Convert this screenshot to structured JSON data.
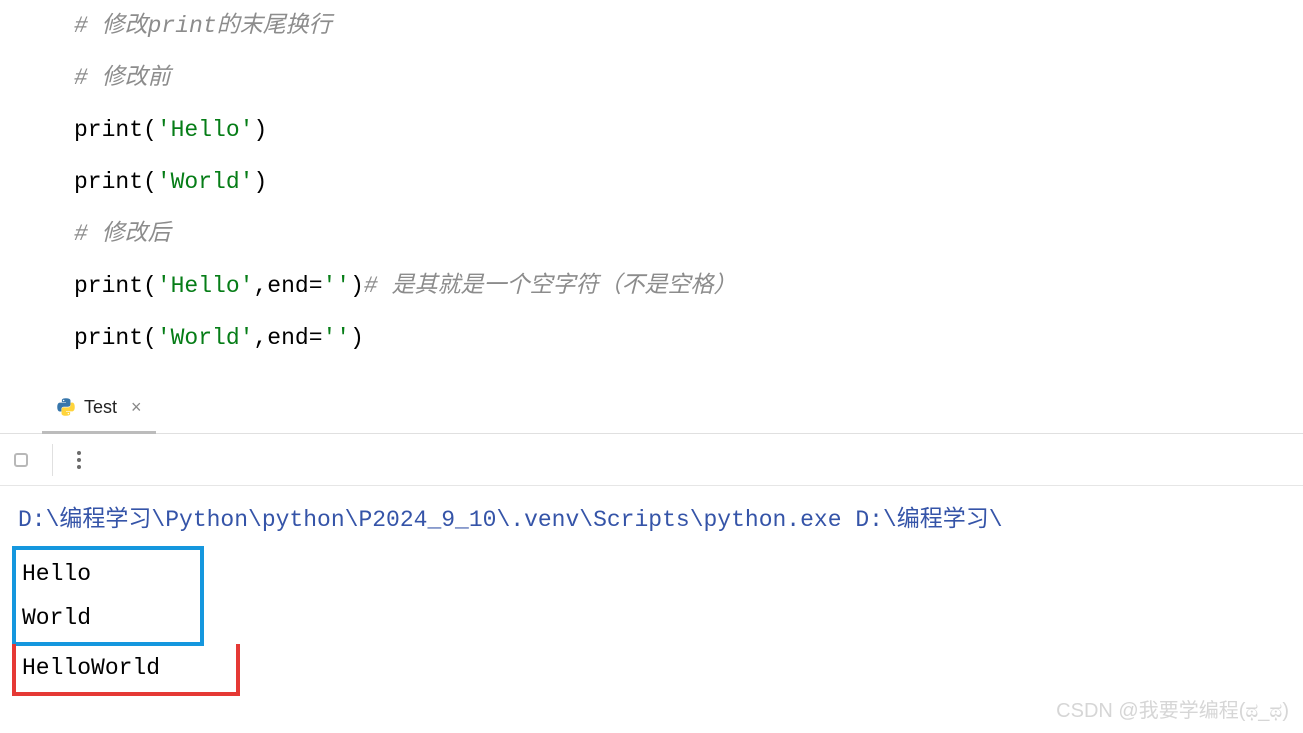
{
  "code": {
    "line1_comment": "# 修改print的末尾换行",
    "line2_comment": "# 修改前",
    "line3_func": "print",
    "line3_str": "'Hello'",
    "line4_func": "print",
    "line4_str": "'World'",
    "line5_comment": "# 修改后",
    "line6_func": "print",
    "line6_str": "'Hello'",
    "line6_arg": "end",
    "line6_val": "''",
    "line6_comment": "# 是其就是一个空字符（不是空格）",
    "line7_func": "print",
    "line7_str": "'World'",
    "line7_arg": "end",
    "line7_val": "''"
  },
  "tab": {
    "label": "Test",
    "close": "×"
  },
  "console": {
    "path": "D:\\编程学习\\Python\\python\\P2024_9_10\\.venv\\Scripts\\python.exe D:\\编程学习\\",
    "output": {
      "line1": "Hello",
      "line2": "World",
      "line3": "HelloWorld"
    }
  },
  "watermark": "CSDN @我要学编程(ಥ_ಥ)"
}
